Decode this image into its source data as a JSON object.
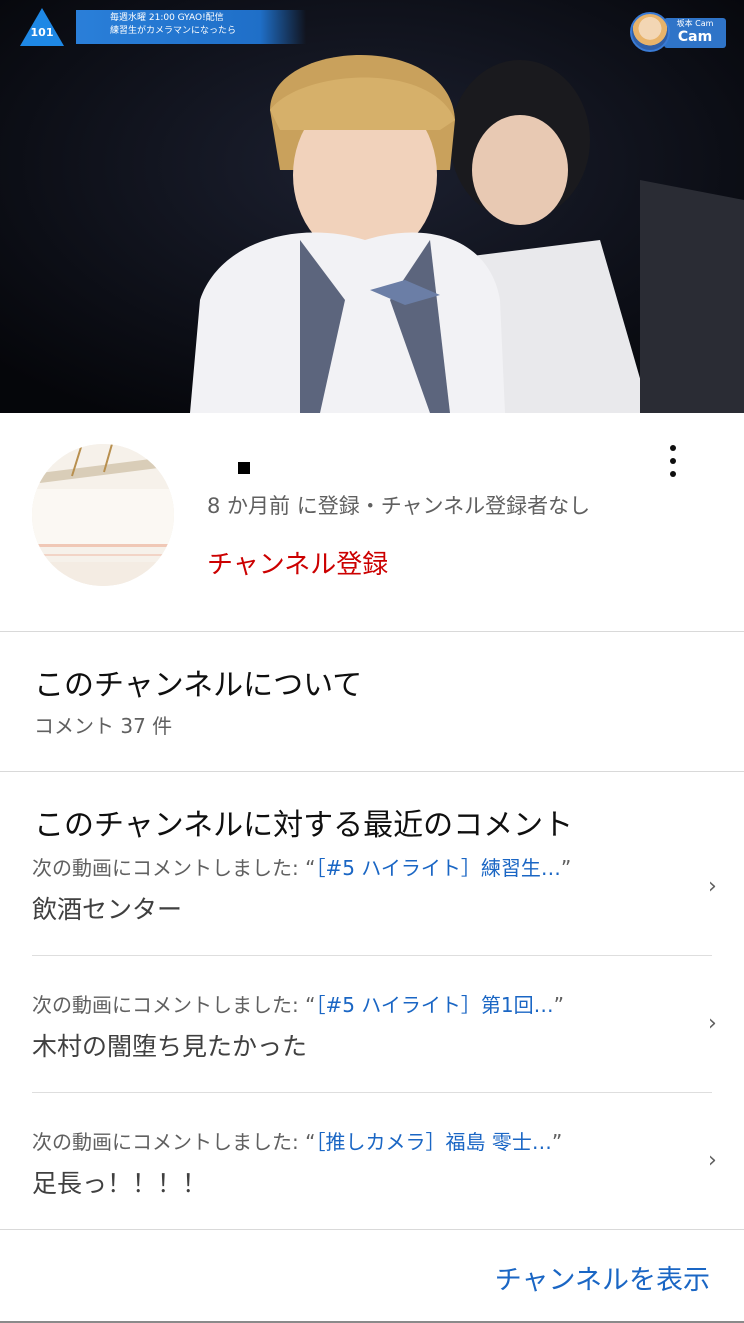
{
  "video": {
    "logo_number": "101",
    "banner_line1": "毎週水曜 21:00 GYAO!配信",
    "banner_line2": "練習生がカメラマンになったら",
    "cam_sub": "坂本 Cam",
    "cam_label": "Cam"
  },
  "channel": {
    "subscribed_info": "8 か月前 に登録・チャンネル登録者なし",
    "subscribe_label": "チャンネル登録",
    "more_icon": "more-vertical-icon"
  },
  "about": {
    "title": "このチャンネルについて",
    "comment_count": "コメント 37 件"
  },
  "recent": {
    "title": "このチャンネルに対する最近のコメント",
    "comments": [
      {
        "prefix": "次の動画にコメントしました: “",
        "video": "［#5 ハイライト］練習生…",
        "suffix": "”",
        "text": "飲酒センター"
      },
      {
        "prefix": "次の動画にコメントしました: “",
        "video": "［#5 ハイライト］第1回…",
        "suffix": "”",
        "text": "木村の闇堕ち見たかった"
      },
      {
        "prefix": "次の動画にコメントしました: “",
        "video": "［推しカメラ］福島 零士…",
        "suffix": "”",
        "text": "足長っ！！！！"
      }
    ]
  },
  "footer": {
    "show_channel": "チャンネルを表示"
  },
  "colors": {
    "subscribe": "#cc0000",
    "link": "#1a66c4",
    "secondary_text": "#606060"
  }
}
